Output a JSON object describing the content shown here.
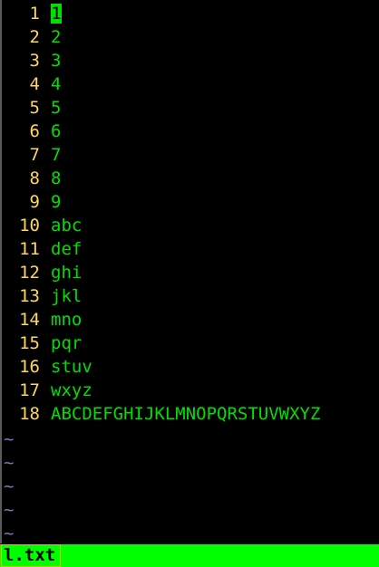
{
  "editor": {
    "lines": [
      {
        "number": "1",
        "text": "1"
      },
      {
        "number": "2",
        "text": "2"
      },
      {
        "number": "3",
        "text": "3"
      },
      {
        "number": "4",
        "text": "4"
      },
      {
        "number": "5",
        "text": "5"
      },
      {
        "number": "6",
        "text": "6"
      },
      {
        "number": "7",
        "text": "7"
      },
      {
        "number": "8",
        "text": "8"
      },
      {
        "number": "9",
        "text": "9"
      },
      {
        "number": "10",
        "text": "abc"
      },
      {
        "number": "11",
        "text": "def"
      },
      {
        "number": "12",
        "text": "ghi"
      },
      {
        "number": "13",
        "text": "jkl"
      },
      {
        "number": "14",
        "text": "mno"
      },
      {
        "number": "15",
        "text": "pqr"
      },
      {
        "number": "16",
        "text": "stuv"
      },
      {
        "number": "17",
        "text": "wxyz"
      },
      {
        "number": "18",
        "text": "ABCDEFGHIJKLMNOPQRSTUVWXYZ"
      }
    ],
    "cursor_line": 1,
    "empty_line_marker": "~",
    "empty_line_count": 5
  },
  "statusbar": {
    "filename": "l.txt"
  },
  "colors": {
    "background": "#000000",
    "line_number": "#ffd75f",
    "text": "#00e000",
    "tilde": "#6f7fb8",
    "statusbar": "#00ff00"
  }
}
